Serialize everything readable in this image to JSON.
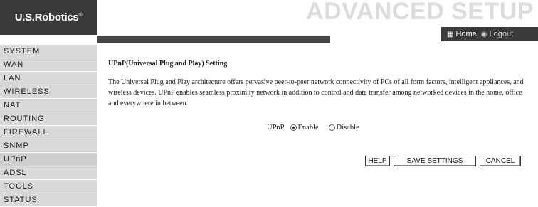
{
  "header": {
    "logo": "U.S.Robotics",
    "logo_mark": "®",
    "title": "ADVANCED SETUP",
    "home_label": "Home",
    "home_icon": "home-icon",
    "logout_label": "Logout",
    "logout_icon": "logout-icon"
  },
  "sidebar": {
    "items": [
      {
        "label": "SYSTEM"
      },
      {
        "label": "WAN"
      },
      {
        "label": "LAN"
      },
      {
        "label": "WIRELESS"
      },
      {
        "label": "NAT"
      },
      {
        "label": "ROUTING"
      },
      {
        "label": "FIREWALL"
      },
      {
        "label": "SNMP"
      },
      {
        "label": "UPnP"
      },
      {
        "label": "ADSL"
      },
      {
        "label": "TOOLS"
      },
      {
        "label": "STATUS"
      }
    ],
    "active": "UPnP"
  },
  "main": {
    "title": "UPnP(Universal Plug and Play) Setting",
    "description": "The Universal Plug and Play architecture offers pervasive peer-to-peer network connectivity of PCs of all form factors, intelligent appliances, and wireless devices. UPnP enables seamless proximity network in addition to control and data transfer among networked devices in the home, office and everywhere in between.",
    "upnp_label": "UPnP",
    "options": [
      {
        "label": "Enable",
        "checked": true
      },
      {
        "label": "Disable",
        "checked": false
      }
    ]
  },
  "buttons": {
    "help": "HELP",
    "save": "SAVE SETTINGS",
    "cancel": "CANCEL"
  },
  "colors": {
    "header_dark": "#3a3a3a",
    "sidebar_bg": "#d9d9d9",
    "title_text": "#dcdcdc"
  }
}
